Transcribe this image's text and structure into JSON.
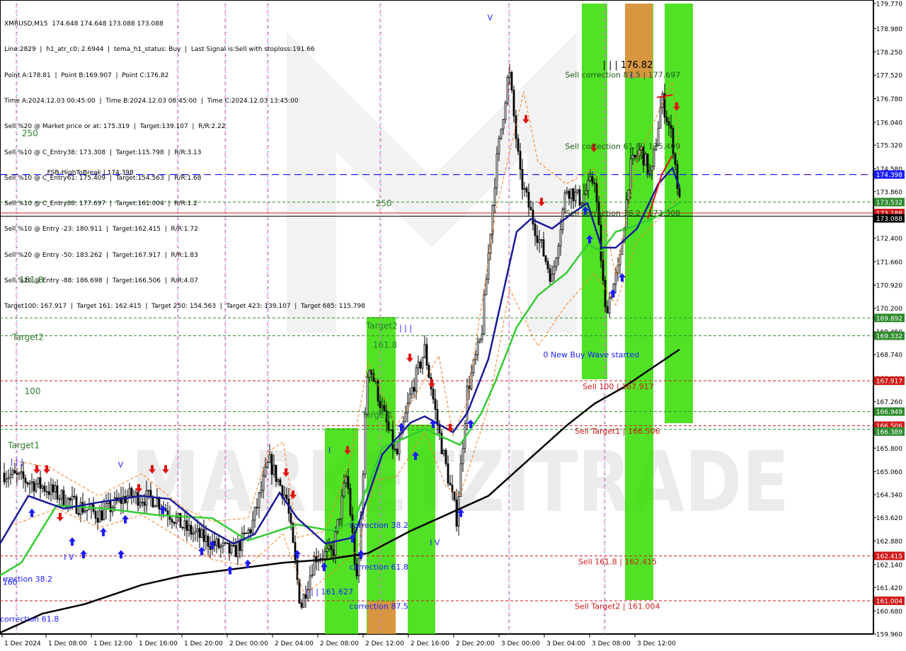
{
  "header": {
    "symbol_line": "XMRUSD,M15  174.648 174.648 173.088 173.088",
    "info_lines": [
      "Line:2829  |  h1_atr_c0: 2.6944  |  tema_h1_status: Buy  |  Last Signal is:Sell with stoploss:191.66",
      "Point A:178.81  |  Point B:169.907  |  Point C:176.82",
      "Time A:2024.12.03 00:45:00  |  Time B:2024.12.03 08:45:00  |  Time C:2024.12.03 13:45:00",
      "Sell %20 @ Market price or at: 175.319  |  Target:139.107  |  R/R:2.22",
      "Sell %10 @ C_Entry38: 173.308  |  Target:115.798  |  R/R:3.13",
      "Sell %10 @ C_Entry61: 175.409  |  Target:154.563  |  R/R:1.68",
      "Sell %10 @ C_Entry88: 177.697  |  Target:161.004  |  R/R:1.2",
      "Sell %10 @ Entry -23: 180.911  |  Target:162.415  |  R/R:1.72",
      "Sell %20 @ Entry -50: 183.262  |  Target:167.917  |  R/R:1.83",
      "Sell %20 @ Entry -88: 186.698  |  Target:166.506  |  R/R:4.07",
      "Target100: 167.917  |  Target 161: 162.415  |  Target 250: 154.563  |  Target 423: 139.107  |  Target 685: 115.798"
    ]
  },
  "chart_data": {
    "type": "candlestick",
    "symbol": "XMRUSD",
    "timeframe": "M15",
    "ohlc_last": {
      "open": 174.648,
      "high": 174.648,
      "low": 173.088,
      "close": 173.088
    },
    "y_axis": {
      "range": [
        159.96,
        179.77
      ],
      "ticks": [
        179.77,
        178.98,
        178.25,
        177.52,
        176.78,
        176.04,
        175.32,
        174.58,
        173.86,
        173.12,
        172.4,
        171.66,
        170.92,
        170.2,
        169.46,
        168.74,
        168.0,
        167.26,
        166.54,
        165.8,
        165.06,
        164.34,
        163.62,
        162.88,
        162.14,
        161.42,
        160.68,
        159.96
      ]
    },
    "x_axis": {
      "labels": [
        "1 Dec 2024",
        "1 Dec 08:00",
        "1 Dec 12:00",
        "1 Dec 16:00",
        "1 Dec 20:00",
        "2 Dec 00:00",
        "2 Dec 04:00",
        "2 Dec 08:00",
        "2 Dec 12:00",
        "2 Dec 16:00",
        "2 Dec 20:00",
        "3 Dec 00:00",
        "3 Dec 04:00",
        "3 Dec 08:00",
        "3 Dec 12:00"
      ]
    },
    "price_tags": [
      {
        "value": 174.398,
        "label": "174.398",
        "color": "#1c1cff"
      },
      {
        "value": 173.532,
        "label": "173.532",
        "color": "#2e8b2e"
      },
      {
        "value": 173.188,
        "label": "173.188",
        "color": "#d11a1a"
      },
      {
        "value": 173.088,
        "label": "173.088",
        "color": "#000000"
      },
      {
        "value": 169.892,
        "label": "169.892",
        "color": "#2e8b2e"
      },
      {
        "value": 169.332,
        "label": "169.332",
        "color": "#2e8b2e"
      },
      {
        "value": 167.917,
        "label": "167.917",
        "color": "#d11a1a"
      },
      {
        "value": 166.949,
        "label": "166.949",
        "color": "#2e8b2e"
      },
      {
        "value": 166.506,
        "label": "166.506",
        "color": "#d11a1a"
      },
      {
        "value": 166.389,
        "label": "166.389",
        "color": "#2e8b2e"
      },
      {
        "value": 162.415,
        "label": "162.415",
        "color": "#d11a1a"
      },
      {
        "value": 161.004,
        "label": "161.004",
        "color": "#d11a1a"
      }
    ],
    "level_labels": [
      {
        "text": "FSB-HighToBreak  |  174.398",
        "value": 174.398,
        "x_frac": 0.054
      },
      {
        "text": "250",
        "value": 175.6,
        "x_frac": 0.025
      },
      {
        "text": "250",
        "value": 173.4,
        "x_frac": 0.43
      },
      {
        "text": "161.8",
        "value": 171.0,
        "x_frac": 0.022
      },
      {
        "text": "Target2",
        "value": 169.2,
        "x_frac": 0.014
      },
      {
        "text": "100",
        "value": 167.5,
        "x_frac": 0.028
      },
      {
        "text": "Target1",
        "value": 165.8,
        "x_frac": 0.009
      },
      {
        "text": "Target2",
        "value": 169.55,
        "x_frac": 0.419
      },
      {
        "text": "161.8",
        "value": 168.95,
        "x_frac": 0.427
      },
      {
        "text": "Target1",
        "value": 166.75,
        "x_frac": 0.414
      }
    ],
    "annotations": [
      {
        "text": "Sell correction 87.5  |  177.697",
        "value": 177.45,
        "x_frac": 0.647,
        "color": "#1a5a1a"
      },
      {
        "text": "Sell correction 61.8  |  175.409",
        "value": 175.2,
        "x_frac": 0.647,
        "color": "#1a5a1a"
      },
      {
        "text": "Sell correction 38.2  |  173.308",
        "value": 173.1,
        "x_frac": 0.647,
        "color": "#1a5a1a"
      },
      {
        "text": "| | | 176.82",
        "value": 177.75,
        "x_frac": 0.69,
        "color": "#000000"
      },
      {
        "text": "0 New Buy Wave started",
        "value": 168.65,
        "x_frac": 0.622,
        "color": "#1c1cff"
      },
      {
        "text": "Sell 100  |  167.917",
        "value": 167.65,
        "x_frac": 0.667,
        "color": "#d11a1a"
      },
      {
        "text": "Sell Target1  |  166.506",
        "value": 166.25,
        "x_frac": 0.658,
        "color": "#d11a1a"
      },
      {
        "text": "Sell 161.8  |  162.415",
        "value": 162.15,
        "x_frac": 0.662,
        "color": "#d11a1a"
      },
      {
        "text": "Sell Target2  |  161.004",
        "value": 160.75,
        "x_frac": 0.658,
        "color": "#d11a1a"
      },
      {
        "text": "correction 38.2",
        "value": 163.3,
        "x_frac": 0.4,
        "color": "#1c1cff"
      },
      {
        "text": "correction 61.8",
        "value": 161.98,
        "x_frac": 0.4,
        "color": "#1c1cff"
      },
      {
        "text": "correction 87.5",
        "value": 160.75,
        "x_frac": 0.4,
        "color": "#1c1cff"
      },
      {
        "text": "| | | 161.627",
        "value": 161.2,
        "x_frac": 0.35,
        "color": "#1c1cff"
      },
      {
        "text": "rrection 38.2",
        "value": 161.6,
        "x_frac": 0.003,
        "color": "#1c1cff"
      },
      {
        "text": "correction 61.8",
        "value": 160.35,
        "x_frac": 0.0,
        "color": "#1c1cff"
      },
      {
        "text": "160",
        "value": 161.5,
        "x_frac": 0.003,
        "color": "#1c1cff"
      },
      {
        "text": "| | |",
        "value": 165.3,
        "x_frac": 0.012,
        "color": "#1c1cff"
      },
      {
        "text": "I V",
        "value": 162.3,
        "x_frac": 0.073,
        "color": "#1c1cff"
      },
      {
        "text": "V",
        "value": 165.2,
        "x_frac": 0.135,
        "color": "#1c1cff"
      },
      {
        "text": "V",
        "value": 179.25,
        "x_frac": 0.558,
        "color": "#1c1cff"
      },
      {
        "text": "I V",
        "value": 162.75,
        "x_frac": 0.492,
        "color": "#1c1cff"
      },
      {
        "text": "| | |",
        "value": 169.5,
        "x_frac": 0.457,
        "color": "#1c1cff"
      },
      {
        "text": "I",
        "value": 177.4,
        "x_frac": 0.722,
        "color": "#1c1cff"
      },
      {
        "text": "I",
        "value": 165.65,
        "x_frac": 0.376,
        "color": "#1c1cff"
      }
    ],
    "watermark": "MARKETZITRADE"
  },
  "colors": {
    "sell_zone": "#33dd00",
    "target_zone": "#ee8844",
    "ema_fast": "#1a1a99",
    "ema_mid": "#33cc33",
    "ema_slow": "#000000",
    "signal_up": "#1c1cff",
    "signal_down": "#e01010"
  }
}
